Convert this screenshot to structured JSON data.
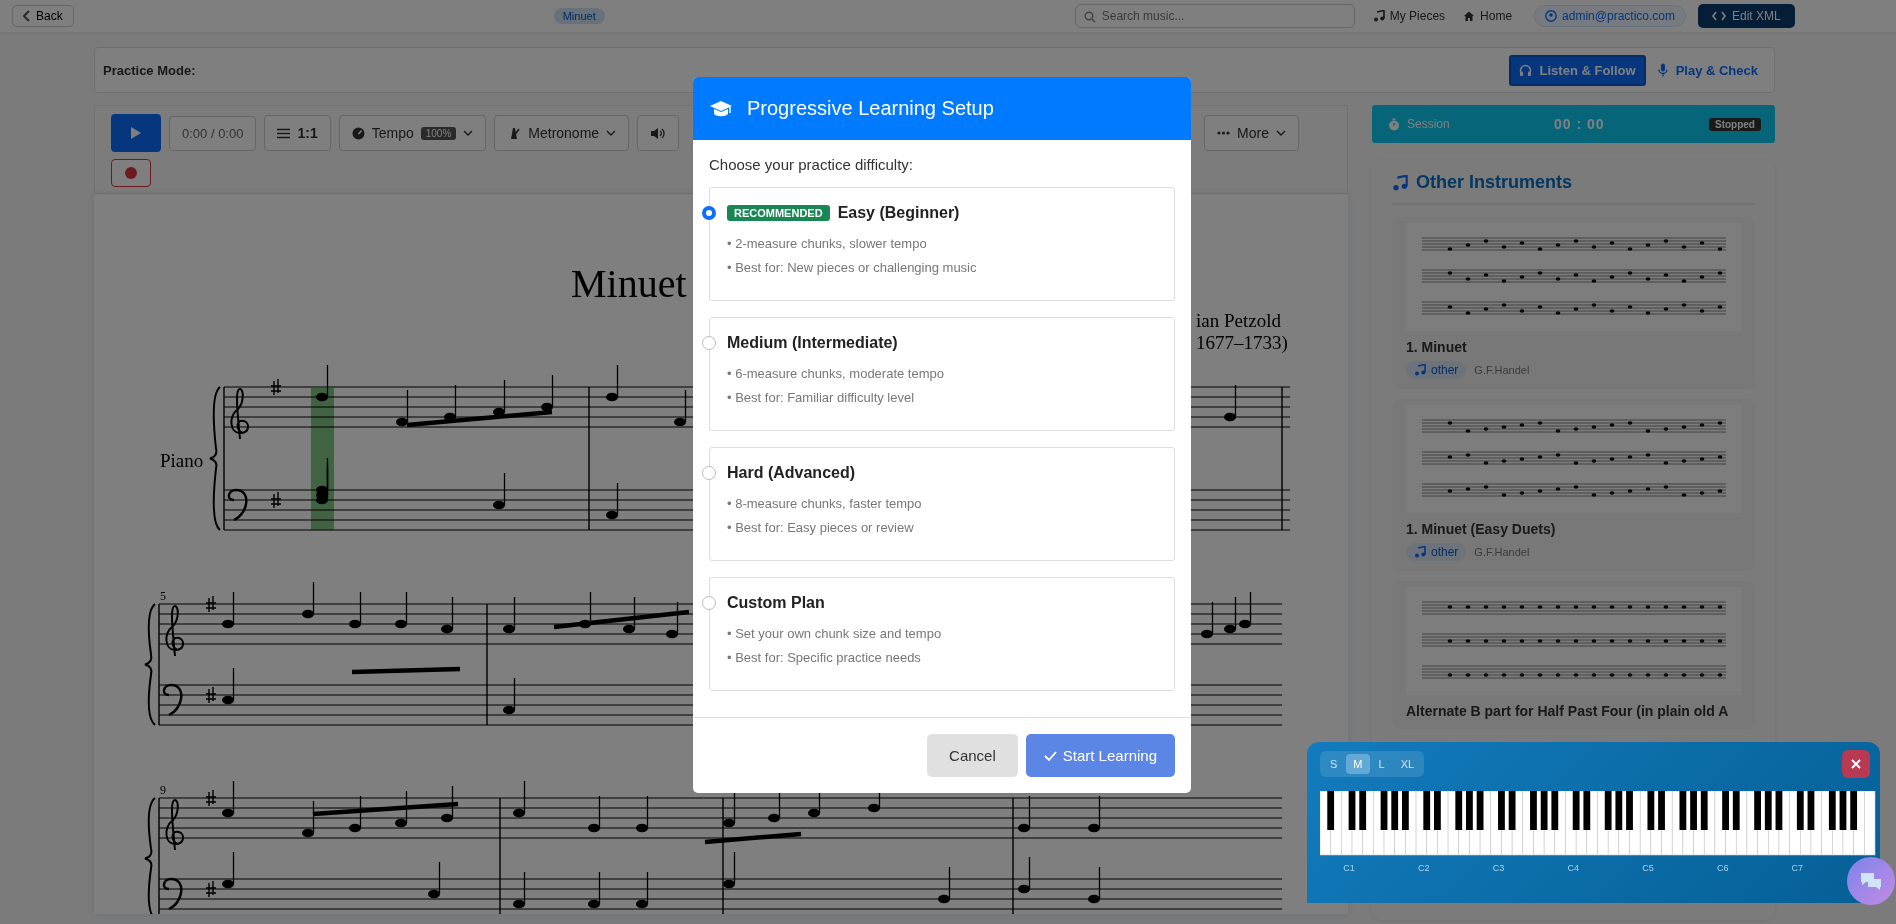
{
  "nav": {
    "back": "Back",
    "piece_badge": "Minuet",
    "search": {
      "placeholder": "Search music..."
    },
    "links": [
      "My Pieces",
      "Home"
    ],
    "user": "admin@practico.com",
    "edit_button": "Edit XML"
  },
  "practice_mode": {
    "label": "Practice Mode:",
    "modes": [
      {
        "label": "Listen & Follow",
        "selected": true
      },
      {
        "label": "Play & Check",
        "selected": false
      }
    ]
  },
  "toolbar": {
    "time": "0:00 / 0:00",
    "zoom": "1:1",
    "tempo": {
      "label": "Tempo",
      "value": "100%"
    },
    "metronome": "Metronome",
    "more": "More"
  },
  "score": {
    "title": "Minuet",
    "composer": "ian Petzold",
    "dates": "1677–1733)",
    "instrument": "Piano",
    "measure_numbers": [
      "5",
      "9"
    ]
  },
  "session": {
    "label": "Session",
    "time": "00 : 00",
    "status": "Stopped"
  },
  "other_instruments": {
    "title": "Other Instruments",
    "pieces": [
      {
        "title": "1. Minuet",
        "tag": "other",
        "composer": "G.F.Handel"
      },
      {
        "title": "1. Minuet (Easy Duets)",
        "tag": "other",
        "composer": "G.F.Handel"
      },
      {
        "title": "Alternate B part for Half Past Four (in plain old A"
      }
    ]
  },
  "piano": {
    "sizes": [
      {
        "label": "S",
        "selected": false
      },
      {
        "label": "M",
        "selected": true
      },
      {
        "label": "L",
        "selected": false
      },
      {
        "label": "XL",
        "selected": false
      }
    ],
    "octave_labels": [
      "C1",
      "C2",
      "C3",
      "C4",
      "C5",
      "C6",
      "C7"
    ]
  },
  "modal": {
    "title": "Progressive Learning Setup",
    "prompt": "Choose your practice difficulty:",
    "options": [
      {
        "title": "Easy (Beginner)",
        "badge": "RECOMMENDED",
        "selected": true,
        "details": [
          "• 2-measure chunks, slower tempo",
          "• Best for: New pieces or challenging music"
        ]
      },
      {
        "title": "Medium (Intermediate)",
        "selected": false,
        "details": [
          "• 6-measure chunks, moderate tempo",
          "• Best for: Familiar difficulty level"
        ]
      },
      {
        "title": "Hard (Advanced)",
        "selected": false,
        "details": [
          "• 8-measure chunks, faster tempo",
          "• Best for: Easy pieces or review"
        ]
      },
      {
        "title": "Custom Plan",
        "selected": false,
        "details": [
          "• Set your own chunk size and tempo",
          "• Best for: Specific practice needs"
        ]
      }
    ],
    "cancel": "Cancel",
    "start": "Start Learning"
  }
}
